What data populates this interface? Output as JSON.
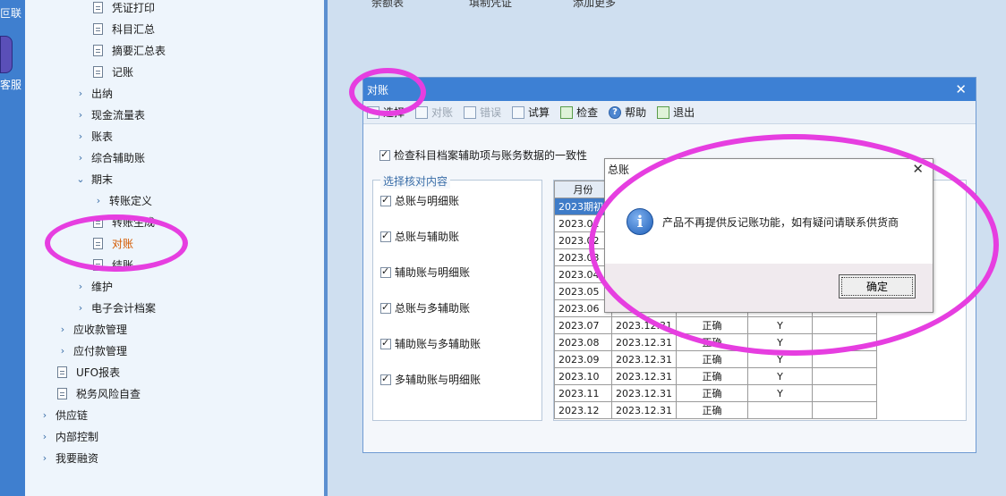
{
  "left_strip": {
    "text_top": "叵联",
    "text_bottom": "客服"
  },
  "top_bar": {
    "items": [
      "余额表",
      "填制凭证",
      "添加更多"
    ]
  },
  "tree": {
    "items": [
      {
        "label": "凭证打印",
        "kind": "doc"
      },
      {
        "label": "科目汇总",
        "kind": "doc"
      },
      {
        "label": "摘要汇总表",
        "kind": "doc"
      },
      {
        "label": "记账",
        "kind": "doc"
      },
      {
        "label": "出纳",
        "kind": "folder"
      },
      {
        "label": "现金流量表",
        "kind": "folder"
      },
      {
        "label": "账表",
        "kind": "folder"
      },
      {
        "label": "综合辅助账",
        "kind": "folder"
      },
      {
        "label": "期末",
        "kind": "folder-open"
      },
      {
        "label": "转账定义",
        "kind": "folder"
      },
      {
        "label": "转账生成",
        "kind": "doc"
      },
      {
        "label": "对账",
        "kind": "doc"
      },
      {
        "label": "结账",
        "kind": "doc"
      },
      {
        "label": "维护",
        "kind": "folder"
      },
      {
        "label": "电子会计档案",
        "kind": "folder"
      },
      {
        "label": "应收款管理",
        "kind": "folder"
      },
      {
        "label": "应付款管理",
        "kind": "folder"
      },
      {
        "label": "UFO报表",
        "kind": "doc"
      },
      {
        "label": "税务风险自查",
        "kind": "doc"
      },
      {
        "label": "供应链",
        "kind": "folder"
      },
      {
        "label": "内部控制",
        "kind": "folder"
      },
      {
        "label": "我要融资",
        "kind": "folder"
      }
    ]
  },
  "dialog": {
    "title": "对账",
    "toolbar": [
      {
        "label": "选择",
        "disabled": false
      },
      {
        "label": "对账",
        "disabled": true
      },
      {
        "label": "错误",
        "disabled": true
      },
      {
        "label": "试算",
        "disabled": false
      },
      {
        "label": "检查",
        "disabled": false
      },
      {
        "label": "帮助",
        "disabled": false
      },
      {
        "label": "退出",
        "disabled": false
      }
    ],
    "top_check_label": "检查科目档案辅助项与账务数据的一致性",
    "group_title": "选择核对内容",
    "group_items": [
      "总账与明细账",
      "总账与辅助账",
      "辅助账与明细账",
      "总账与多辅助账",
      "辅助账与多辅助账",
      "多辅助账与明细账"
    ],
    "grid": {
      "headers": [
        "月份",
        "",
        "",
        "",
        ""
      ],
      "rows": [
        [
          "2023期初",
          "",
          "",
          "",
          ""
        ],
        [
          "2023.01",
          "",
          "",
          "",
          ""
        ],
        [
          "2023.02",
          "",
          "",
          "",
          ""
        ],
        [
          "2023.03",
          "",
          "",
          "",
          ""
        ],
        [
          "2023.04",
          "",
          "",
          "",
          ""
        ],
        [
          "2023.05",
          "",
          "",
          "",
          ""
        ],
        [
          "2023.06",
          "",
          "",
          "",
          ""
        ],
        [
          "2023.07",
          "2023.12.31",
          "正确",
          "Y",
          ""
        ],
        [
          "2023.08",
          "2023.12.31",
          "正确",
          "Y",
          ""
        ],
        [
          "2023.09",
          "2023.12.31",
          "正确",
          "Y",
          ""
        ],
        [
          "2023.10",
          "2023.12.31",
          "正确",
          "Y",
          ""
        ],
        [
          "2023.11",
          "2023.12.31",
          "正确",
          "Y",
          ""
        ],
        [
          "2023.12",
          "2023.12.31",
          "正确",
          "",
          ""
        ]
      ]
    }
  },
  "message_box": {
    "title": "总账",
    "text": "产品不再提供反记账功能，如有疑问请联系供货商",
    "ok_label": "确定"
  },
  "colors": {
    "accent": "#3d80d4",
    "annotation": "#e63ee0",
    "active_tree": "#d45a00"
  }
}
